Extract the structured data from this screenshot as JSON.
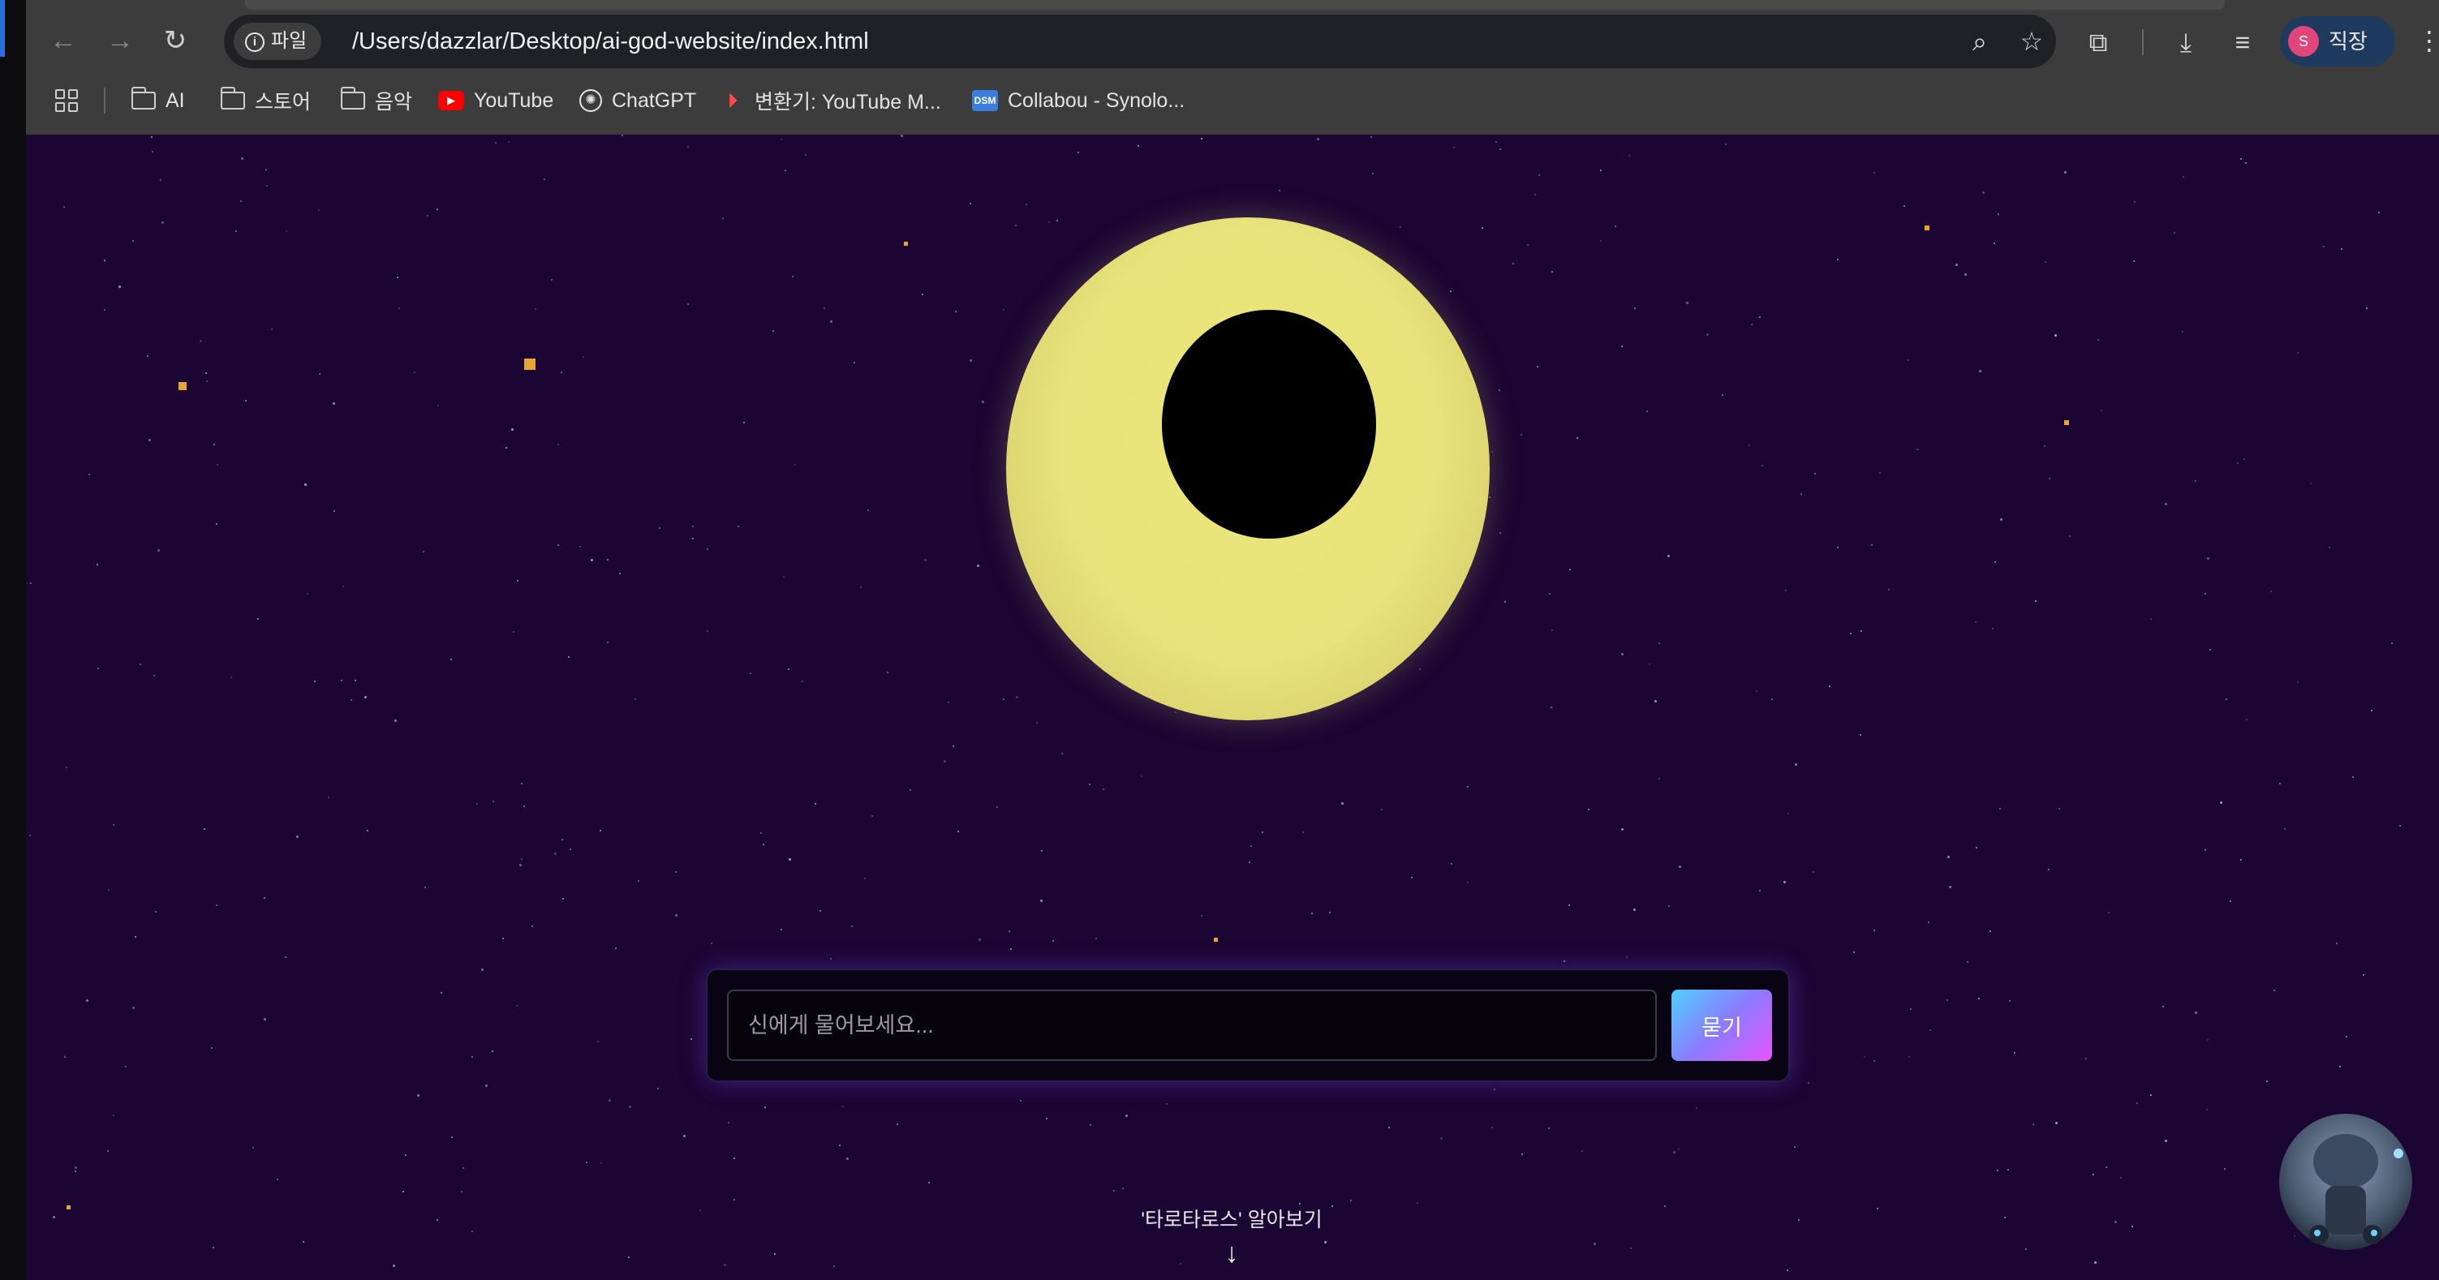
{
  "browser": {
    "chip_label": "파일",
    "url": "/Users/dazzlar/Desktop/ai-god-website/index.html",
    "profile": {
      "initial": "S",
      "name": "직장"
    }
  },
  "bookmarks": [
    {
      "label": "AI",
      "icon": "folder-icon"
    },
    {
      "label": "스토어",
      "icon": "folder-icon"
    },
    {
      "label": "음악",
      "icon": "folder-icon"
    },
    {
      "label": "YouTube",
      "icon": "youtube-icon"
    },
    {
      "label": "ChatGPT",
      "icon": "chatgpt-icon"
    },
    {
      "label": "변환기: YouTube M...",
      "icon": "converter-icon"
    },
    {
      "label": "Collabou - Synolo...",
      "icon": "dsm-icon"
    }
  ],
  "page": {
    "search_placeholder": "신에게 물어보세요...",
    "ask_button": "묻기",
    "learn_more": "'타로타로스' 알아보기"
  },
  "colors": {
    "page_background": "#1a0533",
    "eye": "#e8e37a",
    "pupil": "#000000",
    "button_gradient": [
      "#4fd0ff",
      "#8a7cff",
      "#e455ff"
    ],
    "star_accent": "#e6a53b"
  }
}
